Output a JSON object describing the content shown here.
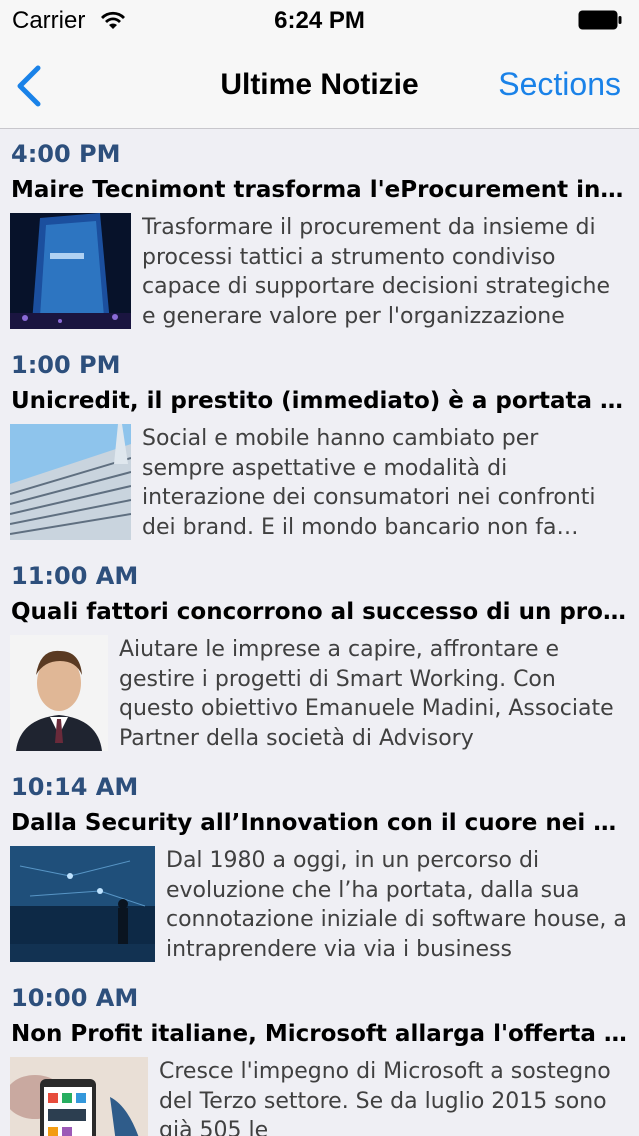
{
  "status_bar": {
    "carrier": "Carrier",
    "time": "6:24 PM"
  },
  "nav": {
    "title": "Ultime Notizie",
    "sections_label": "Sections"
  },
  "articles": [
    {
      "time": "4:00 PM",
      "title": "Maire Tecnimont trasforma l'eProcurement in uno strumento strategico",
      "summary": "Trasformare il procurement da insieme di processi tattici a strumento condiviso capace di supportare decisioni strategiche e generare valore per l'organizzazione"
    },
    {
      "time": "1:00 PM",
      "title": "Unicredit, il prestito (immediato) è a portata di smartphone",
      "summary": "Social e mobile hanno cambiato per sempre aspettative e modalità di interazione dei consumatori nei confronti dei brand. E il mondo bancario non fa eccezione"
    },
    {
      "time": "11:00 AM",
      "title": "Quali fattori concorrono al successo di un progetto di Smart Working",
      "summary": "Aiutare le imprese a capire, affrontare e gestire i progetti di Smart Working. Con questo obiettivo Emanuele Madini, Associate Partner della società di Advisory"
    },
    {
      "time": "10:14 AM",
      "title": "Dalla Security all’Innovation con il cuore nei servizi",
      "summary": "Dal 1980 a oggi, in un percorso di evoluzione che l’ha portata, dalla sua connotazione iniziale di software house, a intraprendere via via i business"
    },
    {
      "time": "10:00 AM",
      "title": "Non Profit italiane, Microsoft allarga l'offerta di donazioni",
      "summary": "Cresce l'impegno di Microsoft a sostegno del Terzo settore. Se da luglio 2015 sono già 505 le"
    }
  ]
}
